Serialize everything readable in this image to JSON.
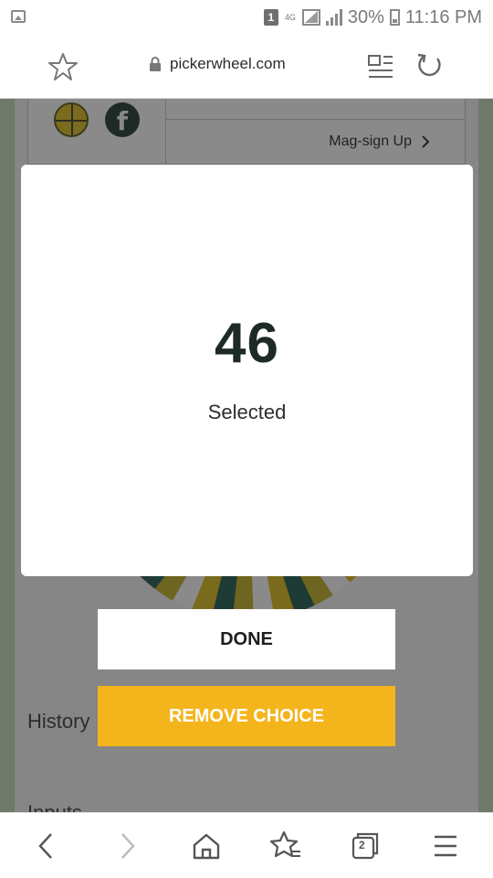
{
  "status_bar": {
    "sim_number": "1",
    "network": "4G",
    "battery_percent": "30%",
    "time": "11:16 PM"
  },
  "browser": {
    "url": "pickerwheel.com",
    "tab_count": "2",
    "icons": [
      "bookmark-star-icon",
      "lock-icon",
      "reader-mode-icon",
      "reload-icon",
      "back-icon",
      "forward-icon",
      "home-icon",
      "bookmarks-icon",
      "tabs-icon",
      "menu-icon"
    ]
  },
  "background_page": {
    "signup_link": "Mag-sign Up",
    "history_heading": "History",
    "inputs_heading": "Inputs"
  },
  "modal": {
    "result_number": "46",
    "result_label": "Selected",
    "done_label": "DONE",
    "remove_label": "REMOVE CHOICE"
  },
  "colors": {
    "accent": "#f4b51c",
    "overlay": "#6f7968"
  }
}
